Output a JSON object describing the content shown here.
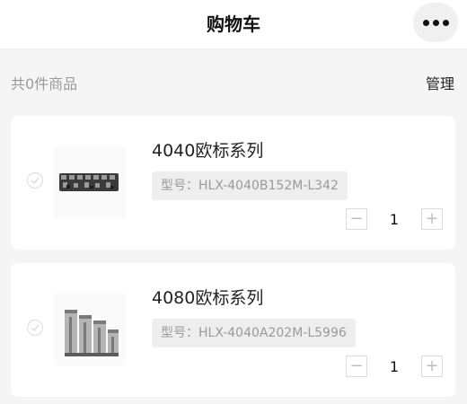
{
  "header": {
    "title": "购物车",
    "more_icon": "more-dots-icon"
  },
  "summary": {
    "count_text": "共0件商品",
    "manage_label": "管理"
  },
  "cart_items": [
    {
      "title": "4040欧标系列",
      "model": "型号：HLX-4040B152M-L342",
      "quantity": "1",
      "minus": "−",
      "plus": "+"
    },
    {
      "title": "4080欧标系列",
      "model": "型号：HLX-4040A202M-L5996",
      "quantity": "1",
      "minus": "−",
      "plus": "+"
    }
  ]
}
